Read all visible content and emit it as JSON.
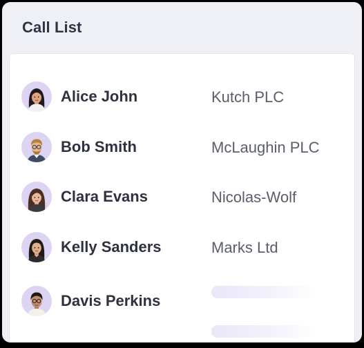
{
  "header": {
    "title": "Call List"
  },
  "contacts": [
    {
      "name": "Alice John",
      "company": "Kutch PLC",
      "avatar_icon": "female-avatar-icon"
    },
    {
      "name": "Bob Smith",
      "company": "McLaughin PLC",
      "avatar_icon": "male-glasses-avatar-icon"
    },
    {
      "name": "Clara Evans",
      "company": "Nicolas-Wolf",
      "avatar_icon": "female-avatar-icon"
    },
    {
      "name": "Kelly Sanders",
      "company": "Marks Ltd",
      "avatar_icon": "female-avatar-icon"
    },
    {
      "name": "Davis Perkins",
      "company": "",
      "avatar_icon": "male-glasses-avatar-icon"
    }
  ],
  "colors": {
    "card_background": "#eef0f6",
    "avatar_background": "#ddd4f4",
    "skeleton_accent": "#e9e7f8",
    "name_text": "#2e3140",
    "company_text": "#5a5e6b"
  }
}
